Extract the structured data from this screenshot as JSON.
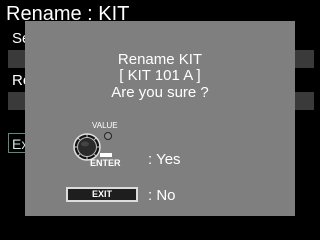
{
  "screen": {
    "title": "Rename : KIT",
    "bg_label_1": "Se",
    "bg_label_2": "Re",
    "bg_exit_label": "Ex"
  },
  "dialog": {
    "line1": "Rename KIT",
    "line2": "[ KIT 101 A ]",
    "line3": "Are you sure ?",
    "value_label": "VALUE",
    "knob_icon": "value-dial-icon",
    "enter_label": "ENTER",
    "yes_label": ": Yes",
    "exit_button_label": "EXIT",
    "no_label": ": No"
  },
  "colors": {
    "background": "#000000",
    "dialog": "#7f7f7f",
    "field": "#3a3a3a",
    "text": "#ffffff"
  }
}
